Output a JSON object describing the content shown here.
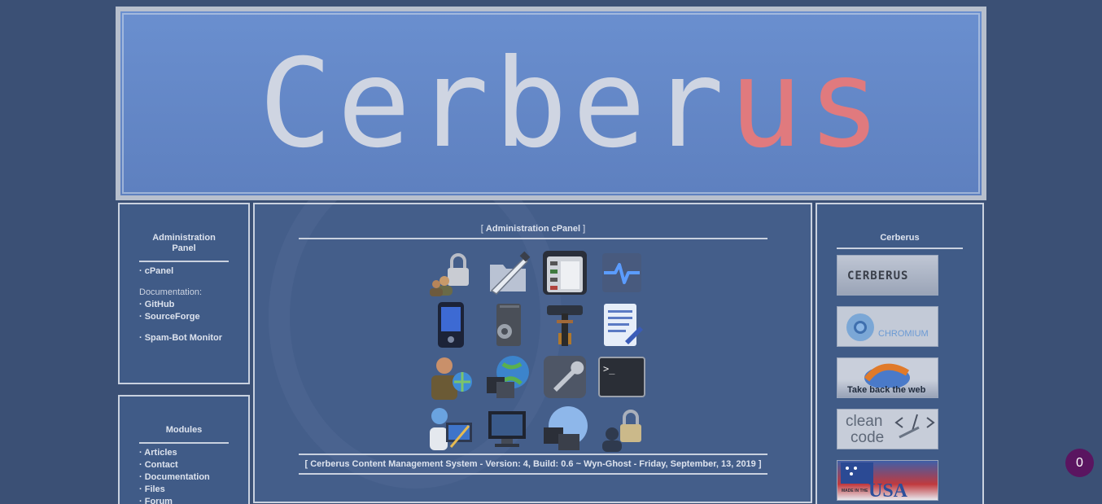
{
  "banner": {
    "logo_main": "Cerber",
    "logo_accent": "us"
  },
  "left_admin": {
    "title": "Administration Panel",
    "cpanel": "· cPanel",
    "doc_label": "Documentation:",
    "github": "· GitHub",
    "sourceforge": "· SourceForge",
    "spam": "· Spam-Bot Monitor"
  },
  "left_modules": {
    "title": "Modules",
    "items": [
      "· Articles",
      "· Contact",
      "· Documentation",
      "· Files",
      "· Forum"
    ]
  },
  "center": {
    "bracket_open": "[ ",
    "title": "Administration cPanel",
    "bracket_close": " ]",
    "footer": "[ Cerberus Content Management System - Version: 4, Build: 0.6 ~ Wyn-Ghost - Friday, September, 13, 2019 ]",
    "icons": [
      "users-lock-icon",
      "knife-folder-icon",
      "window-manager-icon",
      "monitor-pulse-icon",
      "phone-device-icon",
      "server-gear-icon",
      "hammer-tool-icon",
      "document-edit-icon",
      "web-user-icon",
      "network-globe-icon",
      "wrench-icon",
      "terminal-icon",
      "desktop-user-icon",
      "display-settings-icon",
      "devices-globe-icon",
      "user-lock-icon"
    ]
  },
  "right": {
    "title": "Cerberus",
    "badges": {
      "cerberus": "CERBERUS",
      "chromium": "CHROMIUM",
      "firefox": "Take back the web",
      "clean1": "clean",
      "clean2": "code",
      "usa1": "MADE IN THE",
      "usa2": "USA"
    }
  },
  "counter": "0"
}
